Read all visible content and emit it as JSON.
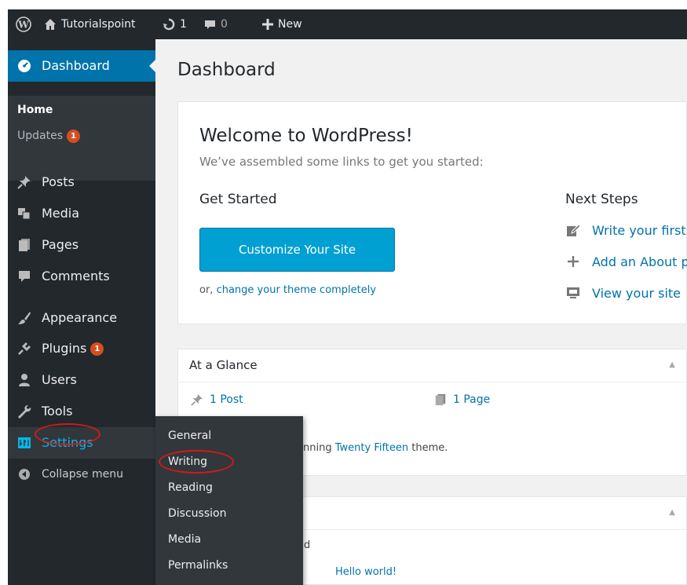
{
  "adminbar": {
    "site_name": "Tutorialspoint",
    "updates_count": "1",
    "comments_count": "0",
    "new_label": "New"
  },
  "sidebar": {
    "dashboard_label": "Dashboard",
    "submenu": {
      "home": "Home",
      "updates": "Updates",
      "updates_badge": "1"
    },
    "items": {
      "posts": "Posts",
      "media": "Media",
      "pages": "Pages",
      "comments": "Comments",
      "appearance": "Appearance",
      "plugins": "Plugins",
      "plugins_badge": "1",
      "users": "Users",
      "tools": "Tools",
      "settings": "Settings",
      "collapse": "Collapse menu"
    }
  },
  "settings_flyout": {
    "items": [
      "General",
      "Writing",
      "Reading",
      "Discussion",
      "Media",
      "Permalinks"
    ]
  },
  "main": {
    "page_title": "Dashboard",
    "welcome": {
      "title": "Welcome to WordPress!",
      "subtitle": "We’ve assembled some links to get you started:",
      "get_started": "Get Started",
      "customize_button": "Customize Your Site",
      "or_text": "or,",
      "change_theme_link": "change your theme completely",
      "next_steps": "Next Steps",
      "next_items": [
        "Write your first",
        "Add an About p",
        "View your site"
      ]
    },
    "glance": {
      "title": "At a Glance",
      "posts": "1 Post",
      "pages": "1 Page",
      "theme_prefix": "nning",
      "theme_name": "Twenty Fifteen",
      "theme_suffix": "theme."
    },
    "activity": {
      "partial_text": "d",
      "hello_link": "Hello world!"
    }
  },
  "colors": {
    "admin_dark": "#23282d",
    "submenu_bg": "#32373c",
    "accent_blue": "#0073aa",
    "button_blue": "#00a0d2",
    "badge_orange": "#d54e21",
    "highlight_red": "#d21a1a",
    "settings_text": "#00b9eb"
  }
}
